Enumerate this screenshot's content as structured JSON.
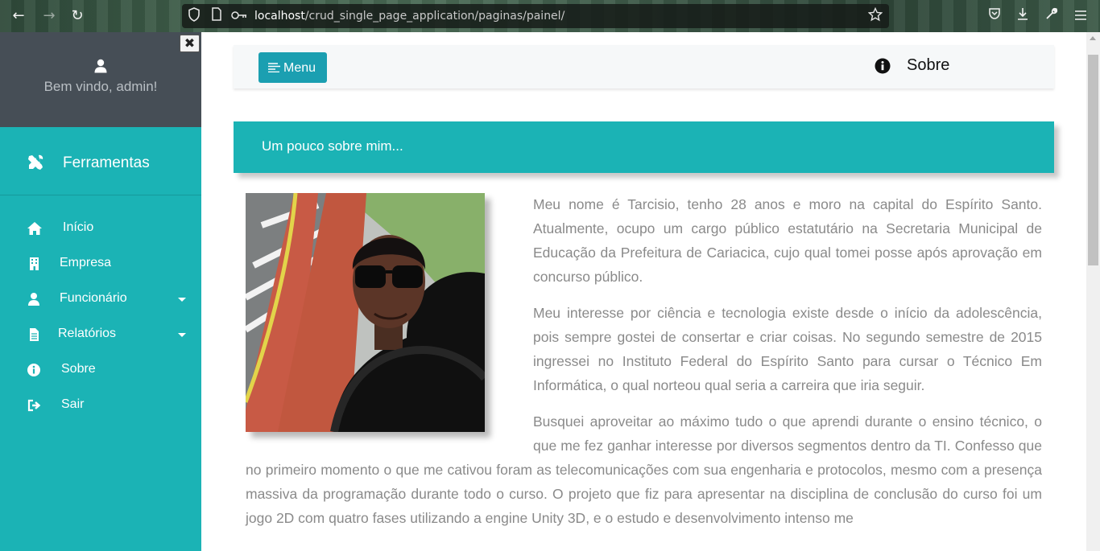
{
  "browser": {
    "url_host": "localhost",
    "url_path": "/crud_single_page_application/paginas/painel/",
    "icons": [
      "back-icon",
      "forward-icon",
      "reload-icon",
      "shield-icon",
      "page-icon",
      "key-icon",
      "star-icon",
      "pocket-icon",
      "download-icon",
      "wrench-icon",
      "hamburger-icon"
    ]
  },
  "sidebar": {
    "welcome": "Bem vindo, admin!",
    "close_glyph": "✖",
    "tools_label": "Ferramentas",
    "items": [
      {
        "label": "Início",
        "icon": "home-icon"
      },
      {
        "label": "Empresa",
        "icon": "building-icon"
      },
      {
        "label": "Funcionário",
        "icon": "user-icon",
        "dropdown": true
      },
      {
        "label": "Relatórios",
        "icon": "file-icon",
        "dropdown": true
      },
      {
        "label": "Sobre",
        "icon": "info-icon"
      },
      {
        "label": "Sair",
        "icon": "sign-out-icon"
      }
    ]
  },
  "topbar": {
    "menu_label": "Menu",
    "about_label": "Sobre"
  },
  "section": {
    "title": "Um pouco sobre mim..."
  },
  "content": {
    "paragraphs": [
      "Meu nome é Tarcisio, tenho 28 anos e moro na capital do Espírito Santo. Atualmente, ocupo um cargo público estatutário na Secretaria Municipal de Educação da Prefeitura de Cariacica, cujo qual tomei posse após aprovação em concurso público.",
      "Meu interesse por ciência e tecnologia existe desde o início da adolescência, pois sempre gostei de consertar e criar coisas. No segundo semestre de 2015 ingressei no Instituto Federal do Espírito Santo para cursar o Técnico Em Informática, o qual norteou qual seria a carreira que iria seguir.",
      "Busquei aproveitar ao máximo tudo o que aprendi durante o ensino técnico, o que me fez ganhar interesse por diversos segmentos dentro da TI. Confesso que no primeiro momento o que me cativou foram as telecomunicações com sua engenharia e protocolos, mesmo com a presença massiva da programação durante todo o curso. O projeto que fiz para apresentar na disciplina de conclusão do curso foi um jogo 2D com quatro fases utilizando a engine Unity 3D, e o estudo e desenvolvimento intenso me"
    ]
  },
  "colors": {
    "teal": "#1bb3b5",
    "user_panel": "#464e56",
    "menu_button": "#1b9fb1",
    "body_text": "#8a8a8a"
  }
}
